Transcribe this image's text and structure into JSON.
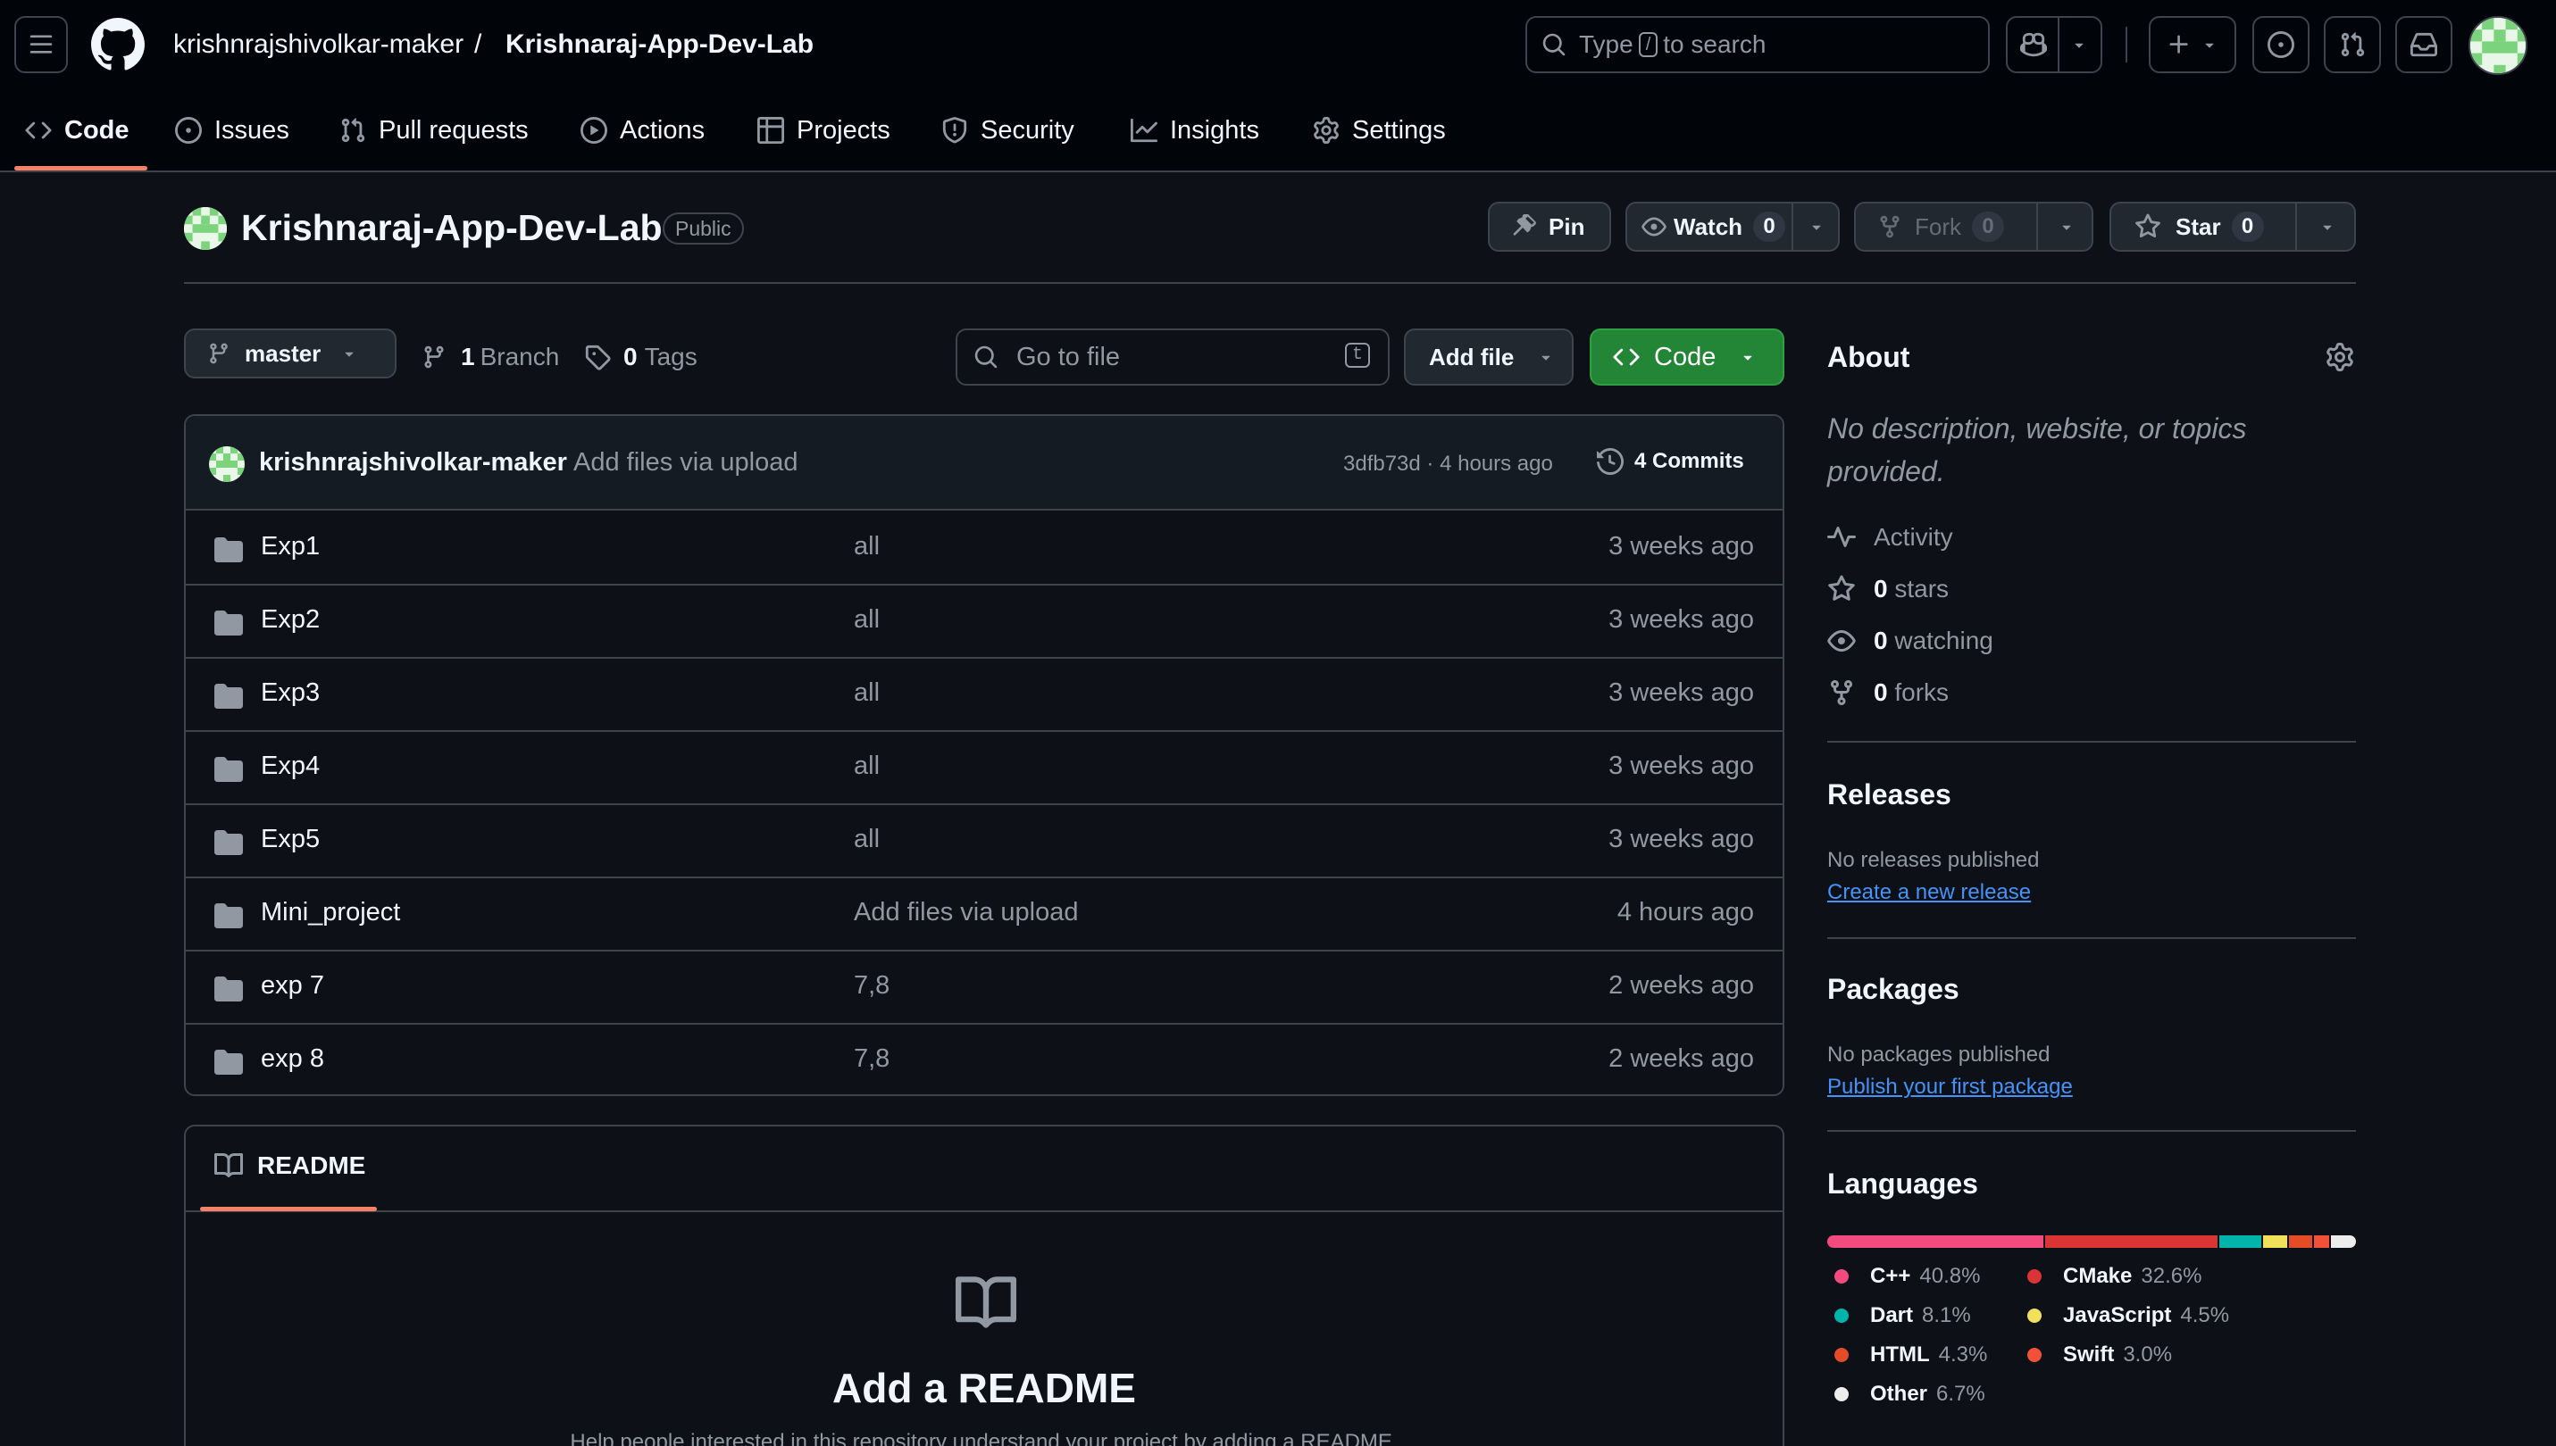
{
  "header": {
    "owner": "krishnrajshivolkar-maker",
    "separator": "/",
    "repo": "Krishnaraj-App-Dev-Lab",
    "search_prefix": "Type",
    "search_key": "/",
    "search_suffix": "to search"
  },
  "nav": {
    "tabs": [
      {
        "label": "Code"
      },
      {
        "label": "Issues"
      },
      {
        "label": "Pull requests"
      },
      {
        "label": "Actions"
      },
      {
        "label": "Projects"
      },
      {
        "label": "Security"
      },
      {
        "label": "Insights"
      },
      {
        "label": "Settings"
      }
    ]
  },
  "repo": {
    "title": "Krishnaraj-App-Dev-Lab",
    "visibility": "Public",
    "pin_label": "Pin",
    "watch_label": "Watch",
    "watch_count": "0",
    "fork_label": "Fork",
    "fork_count": "0",
    "star_label": "Star",
    "star_count": "0"
  },
  "toolbar": {
    "branch": "master",
    "branch_count": "1",
    "branch_label": "Branch",
    "tag_count": "0",
    "tag_label": "Tags",
    "goto_placeholder": "Go to file",
    "goto_key": "t",
    "add_file_label": "Add file",
    "code_label": "Code"
  },
  "commit": {
    "author": "krishnrajshivolkar-maker",
    "message": "Add files via upload",
    "meta": "3dfb73d · 4 hours ago",
    "commits_label": "4 Commits"
  },
  "files": [
    {
      "name": "Exp1",
      "message": "all",
      "time": "3 weeks ago"
    },
    {
      "name": "Exp2",
      "message": "all",
      "time": "3 weeks ago"
    },
    {
      "name": "Exp3",
      "message": "all",
      "time": "3 weeks ago"
    },
    {
      "name": "Exp4",
      "message": "all",
      "time": "3 weeks ago"
    },
    {
      "name": "Exp5",
      "message": "all",
      "time": "3 weeks ago"
    },
    {
      "name": "Mini_project",
      "message": "Add files via upload",
      "time": "4 hours ago"
    },
    {
      "name": "exp 7",
      "message": "7,8",
      "time": "2 weeks ago"
    },
    {
      "name": "exp 8",
      "message": "7,8",
      "time": "2 weeks ago"
    }
  ],
  "readme": {
    "tab_label": "README",
    "heading": "Add a README",
    "help_text": "Help people interested in this repository understand your project by adding a README."
  },
  "about": {
    "heading": "About",
    "description": "No description, website, or topics provided.",
    "activity": "Activity",
    "stars_count": "0",
    "stars_label": "stars",
    "watching_count": "0",
    "watching_label": "watching",
    "forks_count": "0",
    "forks_label": "forks"
  },
  "releases": {
    "heading": "Releases",
    "empty": "No releases published",
    "link": "Create a new release"
  },
  "packages": {
    "heading": "Packages",
    "empty": "No packages published",
    "link": "Publish your first package"
  },
  "languages": {
    "heading": "Languages",
    "items": [
      {
        "name": "C++",
        "percent": "40.8%",
        "value": 40.8,
        "color": "#f34b7d"
      },
      {
        "name": "CMake",
        "percent": "32.6%",
        "value": 32.6,
        "color": "#da3434"
      },
      {
        "name": "Dart",
        "percent": "8.1%",
        "value": 8.1,
        "color": "#00b4ab"
      },
      {
        "name": "JavaScript",
        "percent": "4.5%",
        "value": 4.5,
        "color": "#f1e05a"
      },
      {
        "name": "HTML",
        "percent": "4.3%",
        "value": 4.3,
        "color": "#e34c26"
      },
      {
        "name": "Swift",
        "percent": "3.0%",
        "value": 3.0,
        "color": "#f05138"
      },
      {
        "name": "Other",
        "percent": "6.7%",
        "value": 6.7,
        "color": "#ededed"
      }
    ]
  },
  "colors": {
    "background": "#0d1117",
    "header_bg": "#010409",
    "border": "#3d444d",
    "accent_green": "#238636",
    "link": "#4493f8",
    "active_tab": "#f78166"
  }
}
